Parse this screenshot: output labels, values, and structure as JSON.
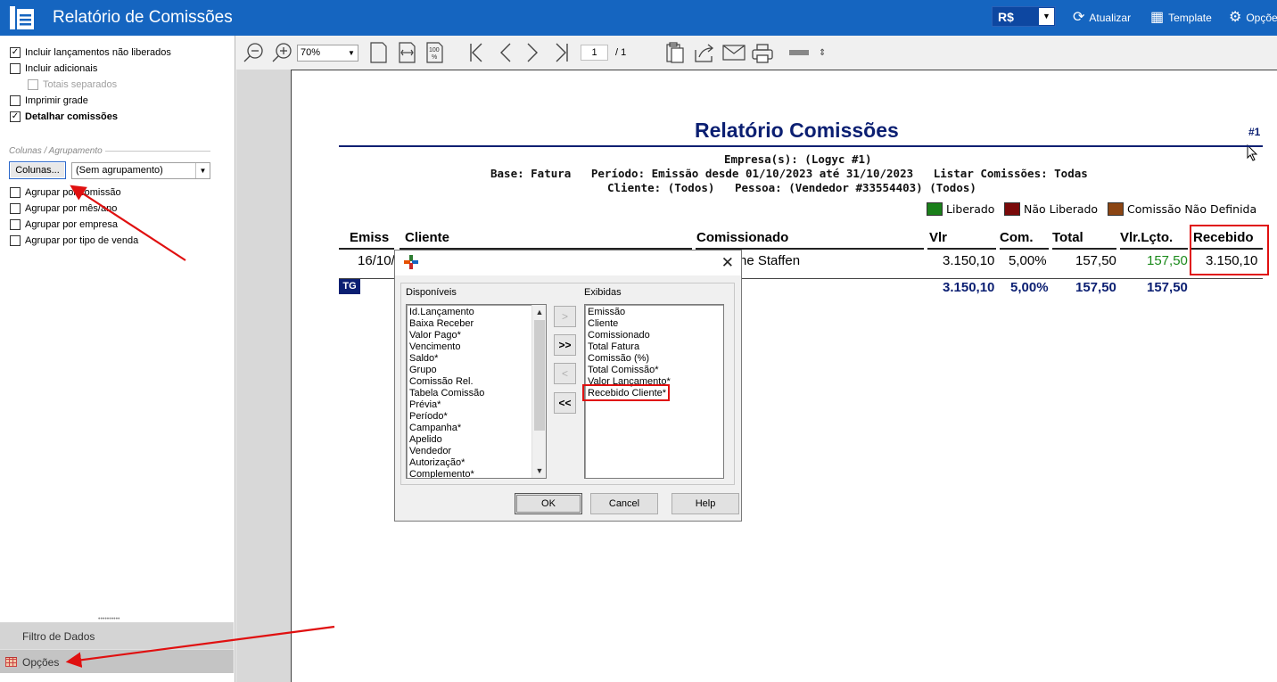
{
  "app": {
    "title": "Relatório de Comissões",
    "currency": "R$",
    "actions": {
      "refresh": "Atualizar",
      "template": "Template",
      "options": "Opções"
    }
  },
  "options_panel": {
    "checkboxes": [
      {
        "label": "Incluir lançamentos não liberados",
        "checked": true
      },
      {
        "label": "Incluir adicionais",
        "checked": false
      },
      {
        "label": "Totais separados",
        "checked": false,
        "disabled": true
      },
      {
        "label": "Imprimir grade",
        "checked": false
      },
      {
        "label": "Detalhar comissões",
        "checked": true
      }
    ],
    "section_label": "Colunas / Agrupamento",
    "columns_button": "Colunas...",
    "grouping_value": "(Sem agrupamento)",
    "group_checkboxes": [
      {
        "label": "Agrupar por comissão",
        "checked": false
      },
      {
        "label": "Agrupar por mês/ano",
        "checked": false
      },
      {
        "label": "Agrupar por empresa",
        "checked": false
      },
      {
        "label": "Agrupar por tipo de venda",
        "checked": false
      }
    ],
    "tabs": {
      "filter": "Filtro de Dados",
      "options": "Opções"
    }
  },
  "preview_toolbar": {
    "zoom": "70%",
    "page_current": "1",
    "page_total": "/ 1"
  },
  "report": {
    "title": "Relatório Comissões",
    "page_number": "#1",
    "header_line1": "Empresa(s): (Logyc #1)",
    "header_line2": "Base: Fatura   Período: Emissão desde 01/10/2023 até 31/10/2023   Listar Comissões: Todas",
    "header_line3": "Cliente: (Todos)   Pessoa: (Vendedor #33554403) (Todos)",
    "legend": [
      {
        "label": "Liberado",
        "color": "#1a7f1a"
      },
      {
        "label": "Não Liberado",
        "color": "#7a0a0a"
      },
      {
        "label": "Comissão Não Definida",
        "color": "#8b4513"
      }
    ],
    "columns": [
      "Emiss",
      "Cliente",
      "Comissionado",
      "Vlr",
      "Com.",
      "Total",
      "Vlr.Lçto.",
      "Recebido"
    ],
    "row": {
      "emissao": "16/10/",
      "comissionado": "ne Staffen",
      "vlr": "3.150,10",
      "com": "5,00%",
      "total": "157,50",
      "vlr_lcto": "157,50",
      "recebido": "3.150,10"
    },
    "totals_badge": "TG",
    "totals": {
      "vlr": "3.150,10",
      "com": "5,00%",
      "total": "157,50",
      "vlr_lcto": "157,50"
    },
    "colors": {
      "title": "#0b1f72",
      "liberado_value": "#1a8a1a",
      "highlight": "#e01010"
    }
  },
  "columns_dialog": {
    "available_label": "Disponíveis",
    "shown_label": "Exibidas",
    "available": [
      "Id.Lançamento",
      "Baixa Receber",
      "Valor Pago*",
      "Vencimento",
      "Saldo*",
      "Grupo",
      "Comissão Rel.",
      "Tabela Comissão",
      "Prévia*",
      "Período*",
      "Campanha*",
      "Apelido",
      "Vendedor",
      "Autorização*",
      "Complemento*"
    ],
    "shown": [
      "Emissão",
      "Cliente",
      "Comissionado",
      "Total Fatura",
      "Comissão (%)",
      "Total Comissão*",
      "Valor Lançamento*",
      "Recebido Cliente*"
    ],
    "move_buttons": [
      ">",
      ">>",
      "<",
      "<<"
    ],
    "buttons": {
      "ok": "OK",
      "cancel": "Cancel",
      "help": "Help"
    }
  }
}
